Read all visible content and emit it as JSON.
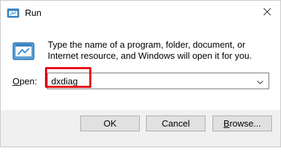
{
  "window": {
    "title": "Run",
    "icon": "run-app-icon",
    "close_icon": "close-icon"
  },
  "dialog": {
    "description": "Type the name of a program, folder, document, or Internet resource, and Windows will open it for you.",
    "open_label_first": "O",
    "open_label_rest": "pen:",
    "input_value": "dxdiag",
    "dropdown_icon": "chevron-down-icon",
    "highlight_color": "#e60012"
  },
  "buttons": {
    "ok": "OK",
    "cancel": "Cancel",
    "browse_first": "B",
    "browse_rest": "rowse..."
  }
}
